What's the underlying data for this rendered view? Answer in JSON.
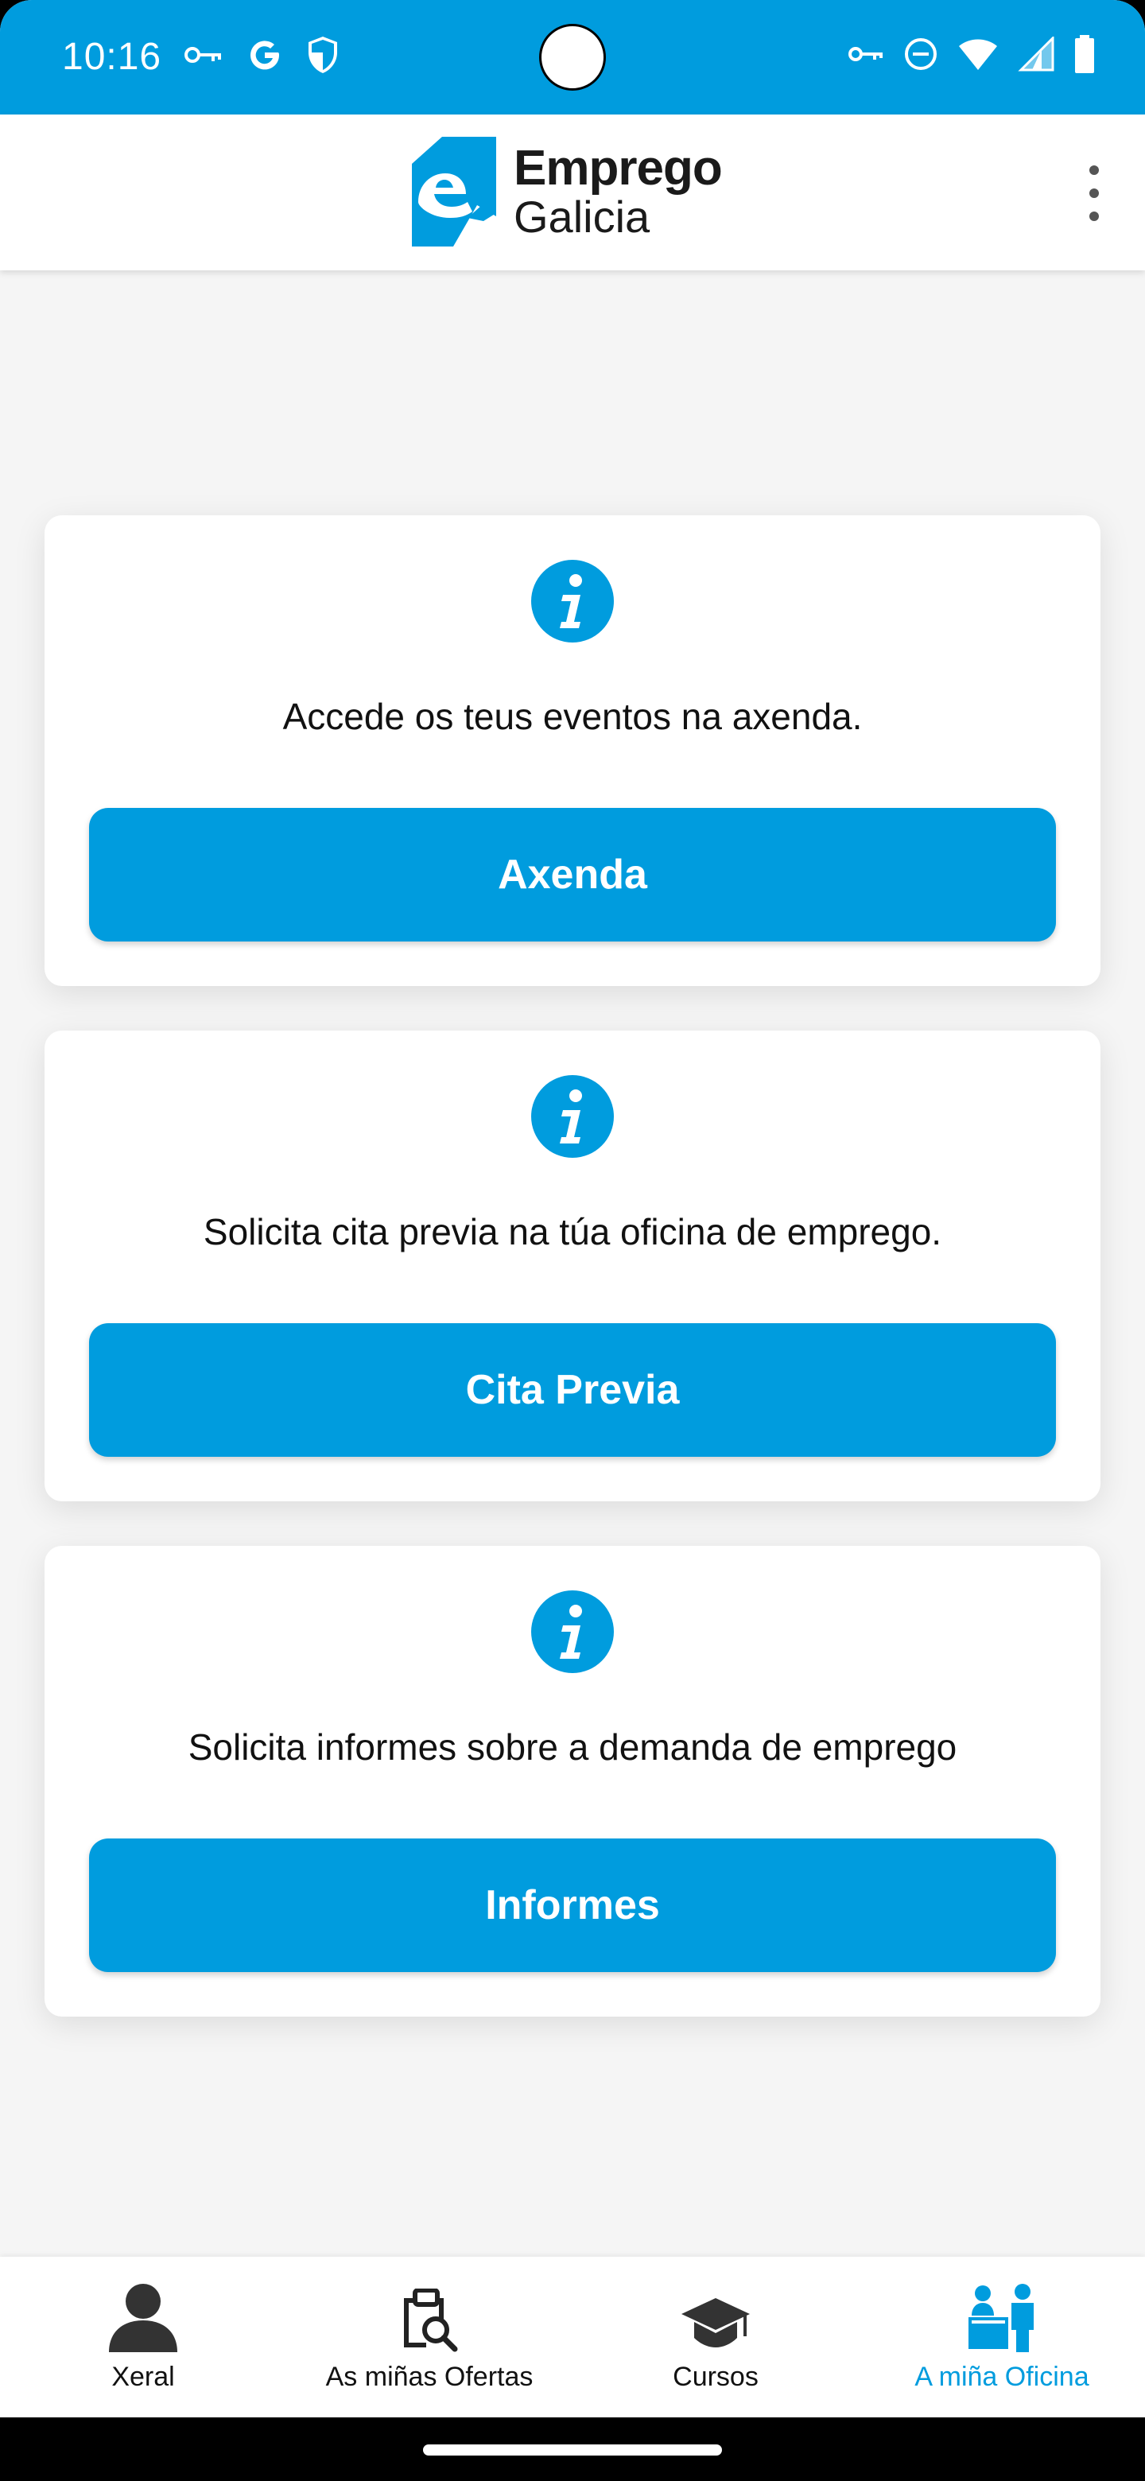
{
  "status_bar": {
    "time": "10:16",
    "left_icons": [
      "vpn-key-icon",
      "google-icon",
      "shield-icon"
    ],
    "right_icons": [
      "vpn-key-icon",
      "do-not-disturb-icon",
      "wifi-icon",
      "signal-icon",
      "battery-icon"
    ]
  },
  "header": {
    "logo_line1": "Emprego",
    "logo_line2": "Galicia",
    "menu_icon": "more-vert-icon"
  },
  "cards": [
    {
      "icon": "info-icon",
      "description": "Accede os teus eventos na axenda.",
      "button_label": "Axenda"
    },
    {
      "icon": "info-icon",
      "description": "Solicita cita previa na túa oficina de emprego.",
      "button_label": "Cita Previa"
    },
    {
      "icon": "info-icon",
      "description": "Solicita informes sobre a demanda de emprego",
      "button_label": "Informes"
    }
  ],
  "bottom_nav": {
    "items": [
      {
        "label": "Xeral",
        "icon": "person-icon",
        "active": false
      },
      {
        "label": "As miñas Ofertas",
        "icon": "clipboard-search-icon",
        "active": false
      },
      {
        "label": "Cursos",
        "icon": "graduation-cap-icon",
        "active": false
      },
      {
        "label": "A miña Oficina",
        "icon": "office-people-icon",
        "active": true
      }
    ]
  },
  "colors": {
    "brand": "#009cde",
    "background": "#f5f5f5",
    "text": "#111111",
    "nav_inactive": "#333333"
  }
}
